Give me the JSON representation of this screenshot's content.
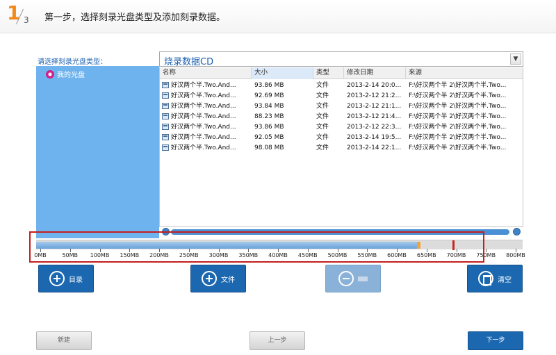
{
  "header": {
    "step_current": "1",
    "step_total": "3",
    "title": "第一步，选择刻录光盘类型及添加刻录数据。"
  },
  "sidebar": {
    "label": "请选择刻录光盘类型：",
    "item": "我的光盘"
  },
  "disc_type": {
    "value": "烧录数据CD"
  },
  "table": {
    "columns": [
      "名称",
      "大小",
      "类型",
      "修改日期",
      "来源"
    ],
    "rows": [
      {
        "name": "好汉两个半.Two.And...",
        "size": "93.86 MB",
        "type": "文件",
        "date": "2013-2-14 20:0...",
        "source": "F:\\好汉两个半 2\\好汉两个半.Two..."
      },
      {
        "name": "好汉两个半.Two.And...",
        "size": "92.69 MB",
        "type": "文件",
        "date": "2013-2-12 21:2...",
        "source": "F:\\好汉两个半 2\\好汉两个半.Two..."
      },
      {
        "name": "好汉两个半.Two.And...",
        "size": "93.84 MB",
        "type": "文件",
        "date": "2013-2-12 21:1...",
        "source": "F:\\好汉两个半 2\\好汉两个半.Two..."
      },
      {
        "name": "好汉两个半.Two.And...",
        "size": "88.23 MB",
        "type": "文件",
        "date": "2013-2-12 21:4...",
        "source": "F:\\好汉两个半 2\\好汉两个半.Two..."
      },
      {
        "name": "好汉两个半.Two.And...",
        "size": "93.86 MB",
        "type": "文件",
        "date": "2013-2-12 22:3...",
        "source": "F:\\好汉两个半 2\\好汉两个半.Two..."
      },
      {
        "name": "好汉两个半.Two.And...",
        "size": "92.05 MB",
        "type": "文件",
        "date": "2013-2-14 19:5...",
        "source": "F:\\好汉两个半 2\\好汉两个半.Two..."
      },
      {
        "name": "好汉两个半.Two.And...",
        "size": "98.08 MB",
        "type": "文件",
        "date": "2013-2-14 22:1...",
        "source": "F:\\好汉两个半 2\\好汉两个半.Two..."
      }
    ]
  },
  "capacity": {
    "used_fraction": 0.8,
    "ticks": [
      "0MB",
      "50MB",
      "100MB",
      "150MB",
      "200MB",
      "250MB",
      "300MB",
      "350MB",
      "400MB",
      "450MB",
      "500MB",
      "550MB",
      "600MB",
      "650MB",
      "700MB",
      "750MB",
      "800MB"
    ]
  },
  "actions": {
    "folder": "目录",
    "file": "文件",
    "remove": "",
    "clear": "清空"
  },
  "footer": {
    "new": "新建",
    "prev": "上一步",
    "next": "下一步"
  },
  "colors": {
    "accent": "#1c68b0",
    "step_orange": "#f08a1c",
    "sidebar_blue": "#6fb3ee",
    "highlight_red": "#c41e1e"
  }
}
